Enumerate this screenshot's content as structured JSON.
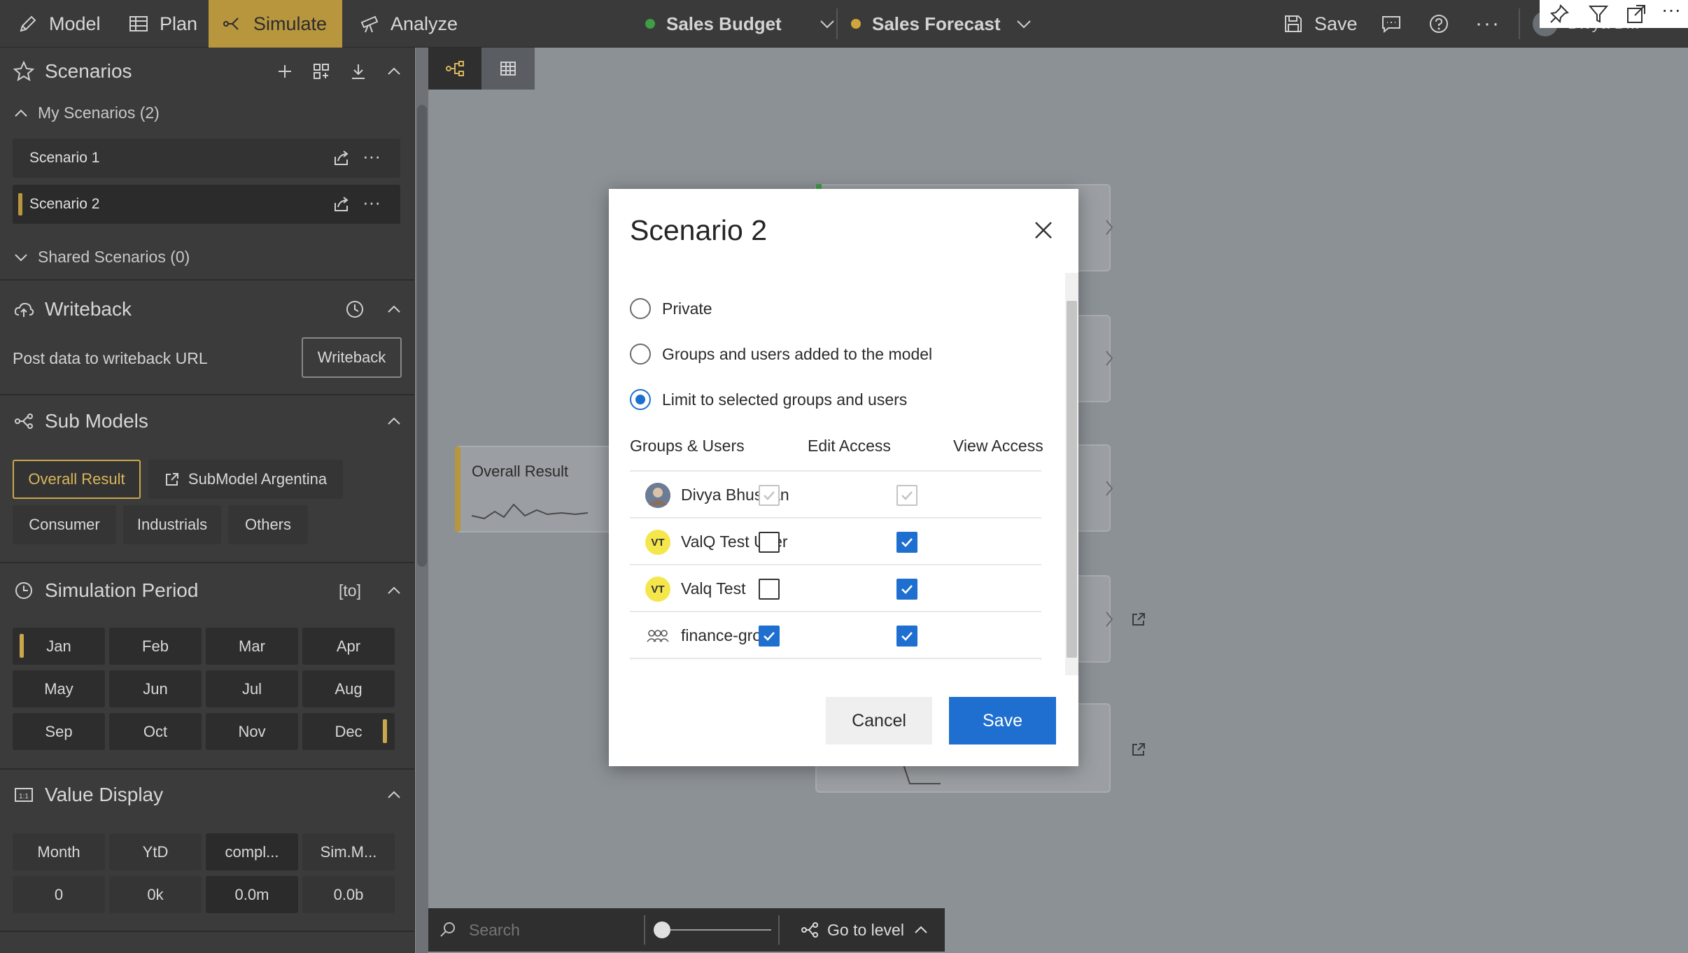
{
  "topbar": {
    "nav": [
      {
        "label": "Model",
        "icon": "pencil-icon"
      },
      {
        "label": "Plan",
        "icon": "table-icon"
      },
      {
        "label": "Simulate",
        "icon": "simulate-icon",
        "active": true
      },
      {
        "label": "Analyze",
        "icon": "telescope-icon"
      }
    ],
    "budget": {
      "label": "Sales Budget",
      "color": "#3f9d45"
    },
    "forecast": {
      "label": "Sales Forecast",
      "color": "#d2a53c"
    },
    "save_label": "Save",
    "user_label": "Divya B..."
  },
  "scenarios": {
    "title": "Scenarios",
    "my_label": "My Scenarios (2)",
    "items": [
      "Scenario 1",
      "Scenario 2"
    ],
    "shared_label": "Shared Scenarios (0)"
  },
  "writeback": {
    "title": "Writeback",
    "desc": "Post data to writeback URL",
    "button": "Writeback"
  },
  "submodels": {
    "title": "Sub Models",
    "overall": "Overall Result",
    "argentina": "SubModel Argentina",
    "chips": [
      "Consumer",
      "Industrials",
      "Others"
    ]
  },
  "simperiod": {
    "title": "Simulation Period",
    "range": "[to]",
    "months": [
      "Jan",
      "Feb",
      "Mar",
      "Apr",
      "May",
      "Jun",
      "Jul",
      "Aug",
      "Sep",
      "Oct",
      "Nov",
      "Dec"
    ]
  },
  "valuedisplay": {
    "title": "Value Display",
    "headers": [
      "Month",
      "YtD",
      "compl...",
      "Sim.M..."
    ],
    "values": [
      "0",
      "0k",
      "0.0m",
      "0.0b"
    ]
  },
  "canvas": {
    "overall_node": "Overall Result",
    "search_placeholder": "Search",
    "goto_label": "Go to level"
  },
  "dialog": {
    "title": "Scenario 2",
    "options": [
      "Private",
      "Groups and users added to the model",
      "Limit to selected groups and users"
    ],
    "selected_option": 2,
    "columns": [
      "Groups & Users",
      "Edit Access",
      "View Access"
    ],
    "users": [
      {
        "name": "Divya Bhushan",
        "avatar": "photo",
        "edit": true,
        "view": true,
        "disabled": true
      },
      {
        "name": "ValQ Test User",
        "avatar": "VT",
        "edit": false,
        "view": true,
        "disabled": false
      },
      {
        "name": "Valq Test",
        "avatar": "VT",
        "edit": false,
        "view": true,
        "disabled": false
      },
      {
        "name": "finance-group",
        "avatar": "group",
        "edit": true,
        "view": true,
        "disabled": false
      }
    ],
    "cancel_label": "Cancel",
    "save_label": "Save"
  },
  "colors": {
    "accent": "#b7963e",
    "primary": "#1e6fd0",
    "sidebar": "#3b3b3b"
  }
}
